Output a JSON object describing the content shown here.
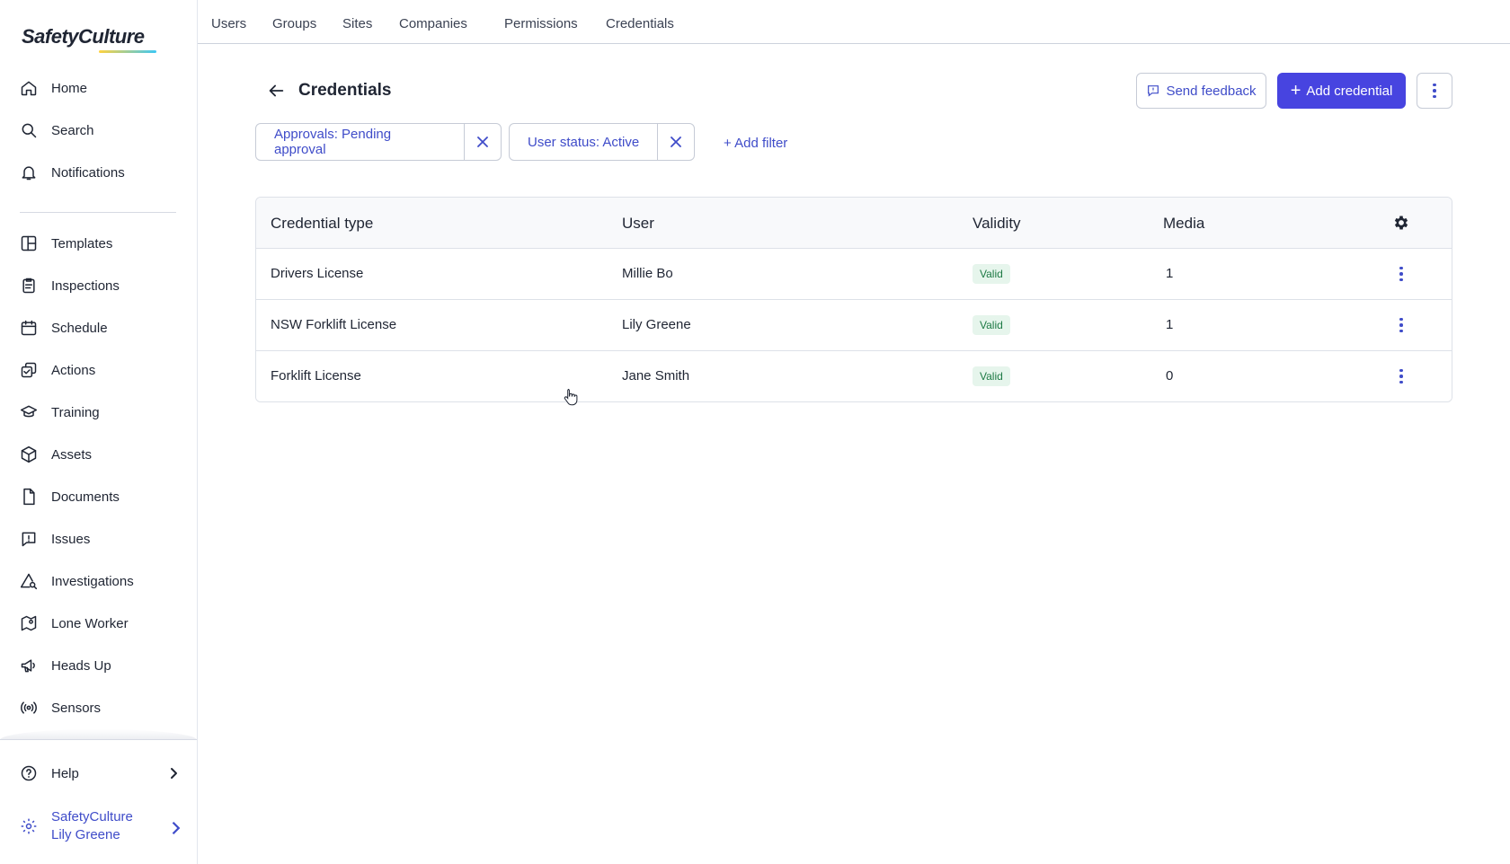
{
  "app": {
    "logo_text": "SafetyCulture"
  },
  "sidebar": {
    "items": [
      {
        "label": "Home",
        "icon": "home-icon"
      },
      {
        "label": "Search",
        "icon": "search-icon"
      },
      {
        "label": "Notifications",
        "icon": "bell-icon"
      },
      {
        "label": "Templates",
        "icon": "templates-icon"
      },
      {
        "label": "Inspections",
        "icon": "clipboard-icon"
      },
      {
        "label": "Schedule",
        "icon": "calendar-icon"
      },
      {
        "label": "Actions",
        "icon": "actions-icon"
      },
      {
        "label": "Training",
        "icon": "graduation-cap-icon"
      },
      {
        "label": "Assets",
        "icon": "cube-icon"
      },
      {
        "label": "Documents",
        "icon": "document-icon"
      },
      {
        "label": "Issues",
        "icon": "issue-icon"
      },
      {
        "label": "Investigations",
        "icon": "investigation-icon"
      },
      {
        "label": "Lone Worker",
        "icon": "lone-worker-icon"
      },
      {
        "label": "Heads Up",
        "icon": "megaphone-icon"
      },
      {
        "label": "Sensors",
        "icon": "sensor-icon"
      }
    ],
    "help_label": "Help",
    "org_name": "SafetyCulture",
    "user_name": "Lily Greene"
  },
  "tabs": [
    "Users",
    "Groups",
    "Sites",
    "Companies",
    "Permissions",
    "Credentials"
  ],
  "header": {
    "title": "Credentials",
    "send_feedback_label": "Send feedback",
    "add_credential_label": "Add credential"
  },
  "filters": [
    {
      "label": "Approvals: Pending approval"
    },
    {
      "label": "User status: Active"
    }
  ],
  "add_filter_label": "+ Add filter",
  "table": {
    "columns": [
      "Credential type",
      "User",
      "Validity",
      "Media"
    ],
    "rows": [
      {
        "credential_type": "Drivers License",
        "user": "Millie Bo",
        "validity": "Valid",
        "media": "1"
      },
      {
        "credential_type": "NSW Forklift License",
        "user": "Lily Greene",
        "validity": "Valid",
        "media": "1"
      },
      {
        "credential_type": "Forklift License",
        "user": "Jane Smith",
        "validity": "Valid",
        "media": "0"
      }
    ]
  },
  "colors": {
    "accent": "#4744e0",
    "link": "#3f4cc9",
    "valid_badge_bg": "#e6f5ec",
    "valid_badge_text": "#1e7a45"
  }
}
